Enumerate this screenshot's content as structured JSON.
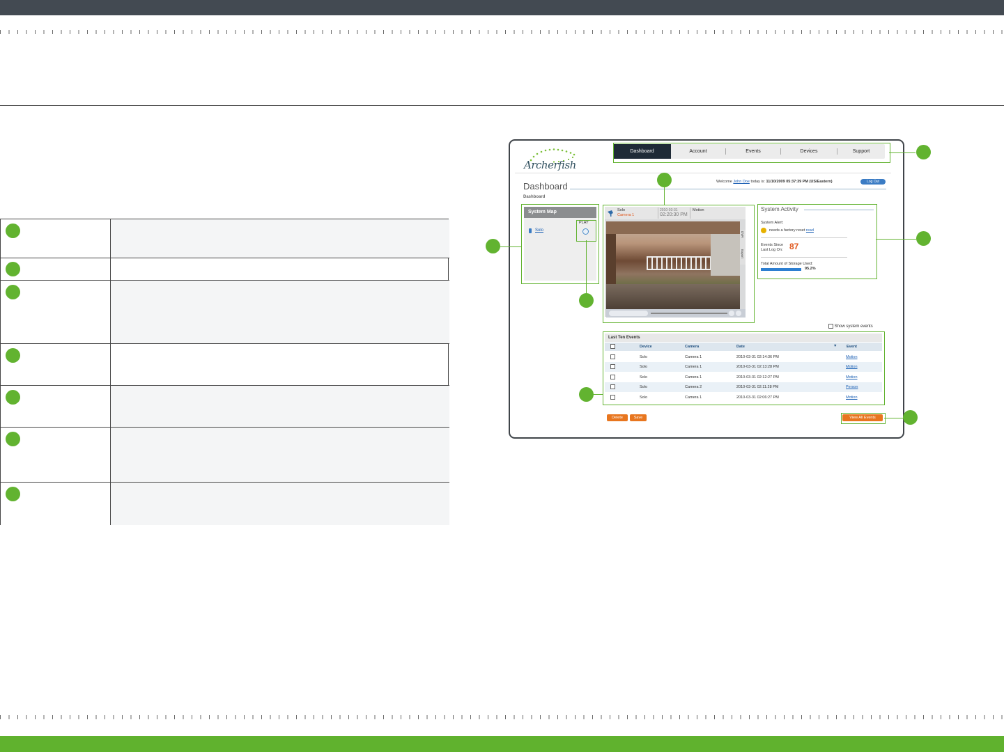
{
  "app": {
    "logo": "Archerfish",
    "nav": [
      "Dashboard",
      "Account",
      "Events",
      "Devices",
      "Support"
    ],
    "active_nav": "Dashboard"
  },
  "dashboard": {
    "title": "Dashboard",
    "breadcrumb": "Dashboard",
    "welcome_prefix": "Welcome",
    "user": "John Doe",
    "welcome_mid": "today is:",
    "datetime": "11/10/2009 05:37:39 PM (US/Eastern)",
    "logout": "Log Out"
  },
  "system_map": {
    "title": "System Map",
    "play_label": "PLAY",
    "device": "Solo"
  },
  "video": {
    "device": "Solo",
    "camera": "Camera 1",
    "date": "2010-03-31",
    "time": "02:20:30 PM",
    "event": "Motion",
    "side_tabs": [
      "DVR",
      "Export"
    ]
  },
  "system_activity": {
    "title": "System Activity",
    "alert_label": "System Alert:",
    "alert_text": "needs a factory reset",
    "alert_link": "read",
    "events_label_1": "Events Since",
    "events_label_2": "Last Log On:",
    "events_count": "87",
    "storage_label": "Total Amount of Storage Used:",
    "storage_value": "95.2%",
    "storage_fraction": 0.952
  },
  "events": {
    "show_system": "Show system events",
    "title": "Last Ten Events",
    "columns": [
      "Device",
      "Camera",
      "Date",
      "Event"
    ],
    "rows": [
      {
        "device": "Solo",
        "camera": "Camera 1",
        "date": "2010-03-31 02:14:36 PM",
        "event": "Motion"
      },
      {
        "device": "Solo",
        "camera": "Camera 1",
        "date": "2010-03-31 02:13:28 PM",
        "event": "Motion"
      },
      {
        "device": "Solo",
        "camera": "Camera 1",
        "date": "2010-03-31 02:12:27 PM",
        "event": "Motion"
      },
      {
        "device": "Solo",
        "camera": "Camera 2",
        "date": "2010-03-31 02:11:28 PM",
        "event": "Person"
      },
      {
        "device": "Solo",
        "camera": "Camera 1",
        "date": "2010-03-31 02:06:27 PM",
        "event": "Motion"
      }
    ],
    "delete_label": "Delete",
    "save_label": "Save",
    "view_all_label": "View All Events"
  },
  "colors": {
    "accent_green": "#62b330",
    "nav_active": "#1f2b37",
    "button_orange": "#e8761f",
    "link_blue": "#1a5fb4",
    "count_orange": "#e0561b"
  }
}
